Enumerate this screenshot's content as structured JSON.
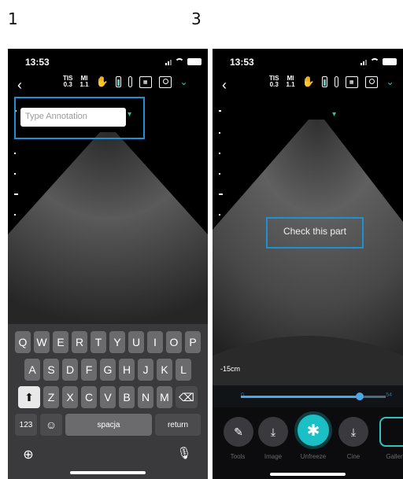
{
  "step_labels": {
    "left": "1",
    "right": "3"
  },
  "status": {
    "time": "13:53"
  },
  "toolbar": {
    "tis_label": "TIS",
    "tis_value": "0.3",
    "mi_label": "MI",
    "mi_value": "1.1",
    "icons": [
      "back-icon",
      "hand-icon",
      "battery-icon",
      "thermometer-icon",
      "frame-icon",
      "person-icon",
      "chevron-down-icon"
    ]
  },
  "left_screen": {
    "annotation_placeholder": "Type Annotation",
    "keyboard": {
      "row1": [
        "Q",
        "W",
        "E",
        "R",
        "T",
        "Y",
        "U",
        "I",
        "O",
        "P"
      ],
      "row2": [
        "A",
        "S",
        "D",
        "F",
        "G",
        "H",
        "J",
        "K",
        "L"
      ],
      "row3": [
        "Z",
        "X",
        "C",
        "V",
        "B",
        "N",
        "M"
      ],
      "numbers_key": "123",
      "space_key": "spacja",
      "return_key": "return"
    }
  },
  "right_screen": {
    "annotation_text": "Check this part",
    "depth_label": "15cm",
    "slider": {
      "min_label": "0",
      "max_label": "54",
      "value_fraction": 0.82
    },
    "tools": [
      {
        "label": "Tools",
        "icon": "pencil-icon"
      },
      {
        "label": "Image",
        "icon": "download-icon"
      },
      {
        "label": "Unfreeze",
        "icon": "snowflake-icon"
      },
      {
        "label": "Cine",
        "icon": "download-icon"
      },
      {
        "label": "Galler",
        "icon": "gallery-icon"
      }
    ]
  },
  "colors": {
    "highlight": "#1e90d6",
    "accent": "#1ac0c6",
    "background": "#000000"
  }
}
